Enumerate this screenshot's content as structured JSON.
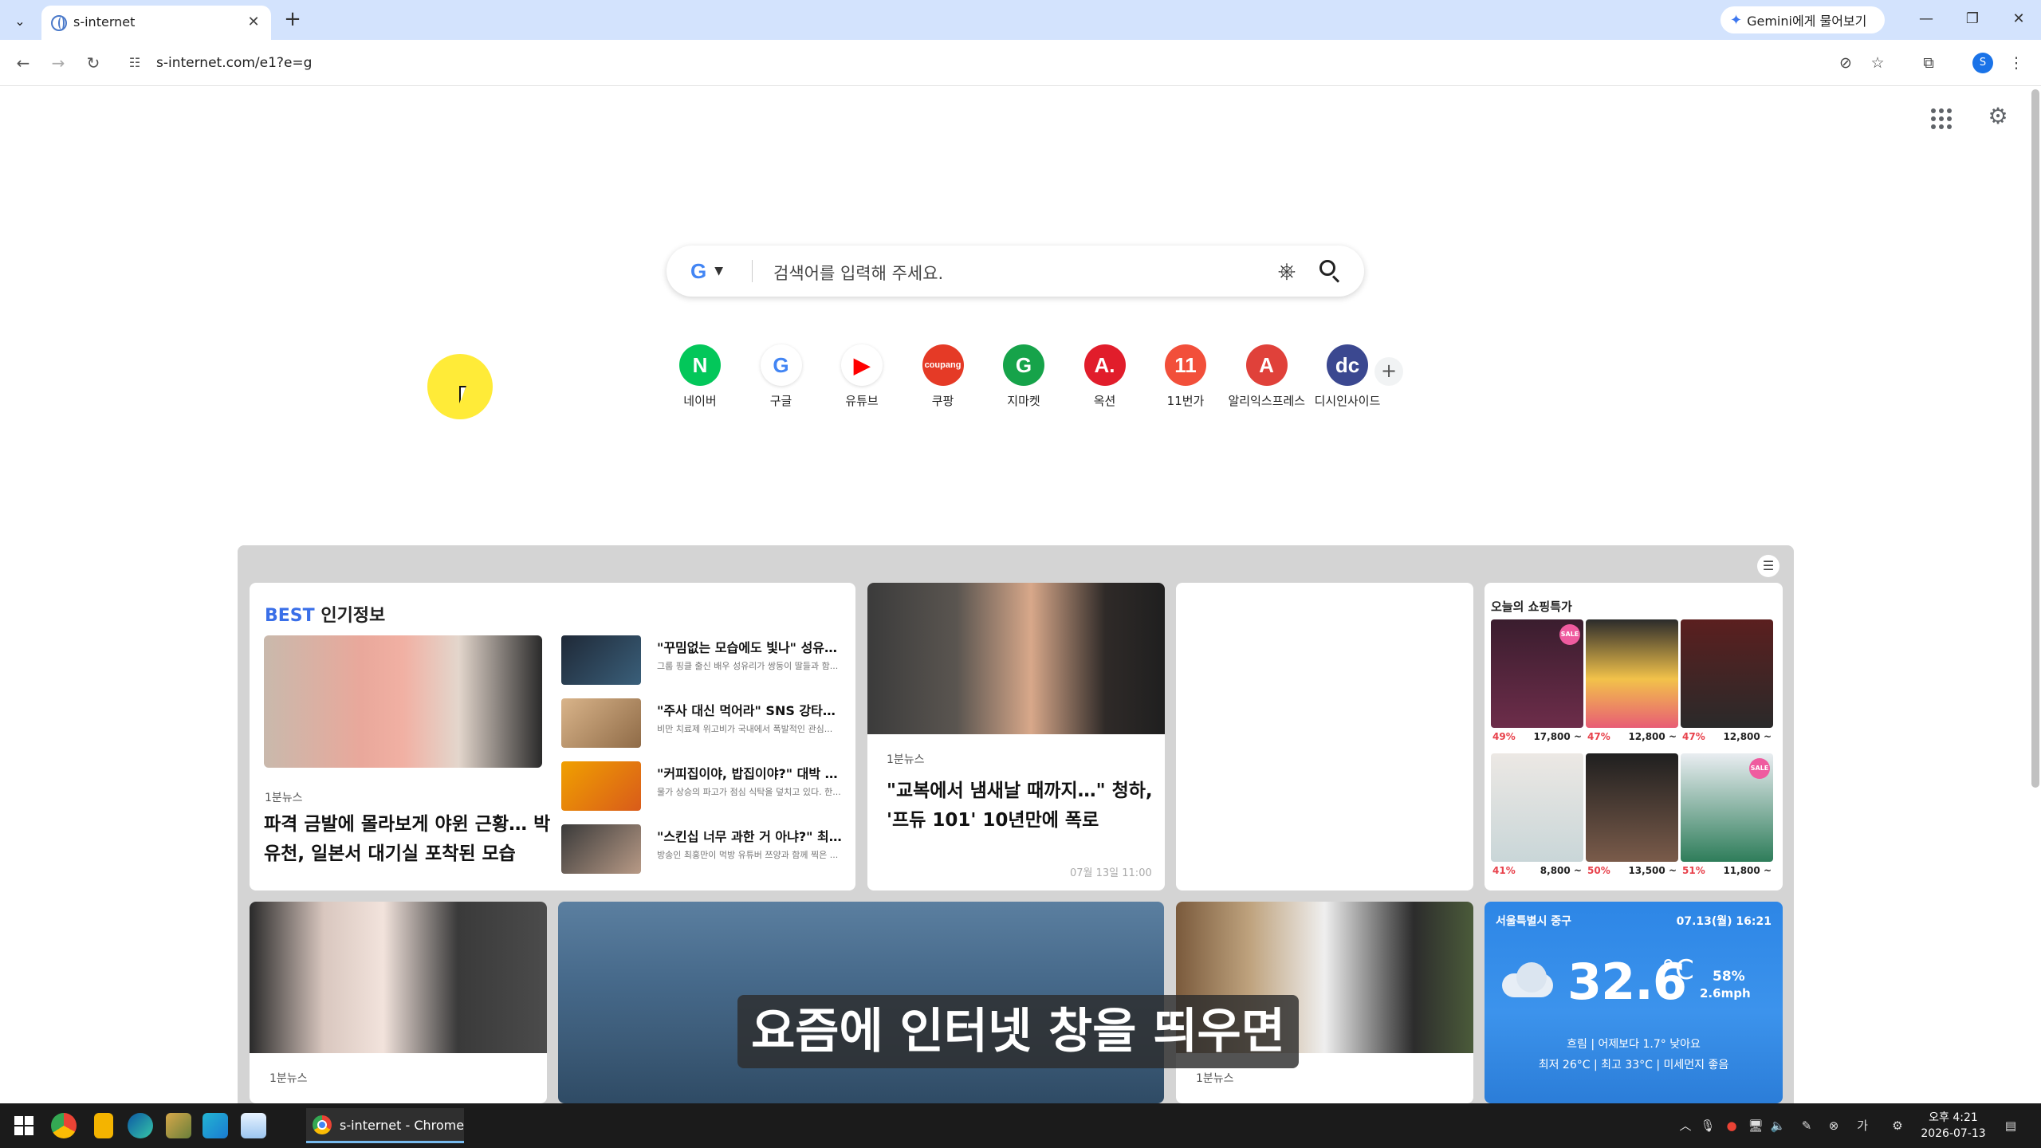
{
  "browser": {
    "tab_title": "s-internet",
    "gemini_label": "Gemini에게 물어보기",
    "url": "s-internet.com/e1?e=g"
  },
  "search": {
    "placeholder": "검색어를 입력해 주세요."
  },
  "shortcuts": [
    {
      "label": "네이버",
      "glyph": "N",
      "color": "#03c75a",
      "fg": "#ffffff"
    },
    {
      "label": "구글",
      "glyph": "G",
      "color": "#ffffff",
      "fg": "#4285f4"
    },
    {
      "label": "유튜브",
      "glyph": "▶",
      "color": "#ffffff",
      "fg": "#ff0000"
    },
    {
      "label": "쿠팡",
      "glyph": "coupang",
      "color": "#e53a26",
      "fg": "#ffffff"
    },
    {
      "label": "지마켓",
      "glyph": "G",
      "color": "#16a34a",
      "fg": "#ffffff"
    },
    {
      "label": "옥션",
      "glyph": "A.",
      "color": "#e11d2b",
      "fg": "#ffffff"
    },
    {
      "label": "11번가",
      "glyph": "11",
      "color": "#f24f3a",
      "fg": "#ffffff"
    },
    {
      "label": "알리익스프레스",
      "glyph": "A",
      "color": "#e0413a",
      "fg": "#ffffff"
    },
    {
      "label": "디시인사이드",
      "glyph": "dc",
      "color": "#3b4890",
      "fg": "#ffffff"
    }
  ],
  "best": {
    "prefix": "BEST",
    "title": "인기정보",
    "main": {
      "source": "1분뉴스",
      "headline_line1": "파격 금발에 몰라보게 야윈 근황… 박",
      "headline_line2": "유천, 일본서 대기실 포착된 모습"
    },
    "items": [
      {
        "title": "\"꾸밈없는 모습에도 빛나\" 성유리, ...",
        "snippet": "그룹 핑클 출신 배우 성유리가 쌍둥이 딸들과 함..."
      },
      {
        "title": "\"주사 대신 먹어라\" SNS 강타한 '...",
        "snippet": "비만 치료제 위고비가 국내에서 폭발적인 관심..."
      },
      {
        "title": "\"커피집이야, 밥집이야?\" 대박 터...",
        "snippet": "물가 상승의 파고가 점심 식탁을 덮치고 있다. 한..."
      },
      {
        "title": "\"스킨십 너무 과한 거 아냐?\" 최홍...",
        "snippet": "방송인 최홍만이 먹방 유튜버 쯔양과 함께 찍은 ..."
      }
    ]
  },
  "feature": {
    "source": "1분뉴스",
    "headline_line1": "\"교복에서 냄새날 때까지…\" 청하,",
    "headline_line2": "'프듀 101' 10년만에 폭로",
    "time": "07월 13일 11:00"
  },
  "shopping": {
    "title": "오늘의 쇼핑특가",
    "items": [
      {
        "pct": "49%",
        "price": "17,800 ~"
      },
      {
        "pct": "47%",
        "price": "12,800 ~"
      },
      {
        "pct": "47%",
        "price": "12,800 ~"
      },
      {
        "pct": "41%",
        "price": "8,800 ~"
      },
      {
        "pct": "50%",
        "price": "13,500 ~"
      },
      {
        "pct": "51%",
        "price": "11,800 ~"
      }
    ]
  },
  "row2": {
    "left_source": "1분뉴스",
    "right_source": "1분뉴스"
  },
  "weather": {
    "location": "서울특별시 중구",
    "date": "07.13(월) 16:21",
    "temp": "32.6",
    "unit": "°C",
    "humidity": "58%",
    "wind": "2.6mph",
    "condition": "흐림  |  어제보다 1.7° 낮아요",
    "minmax": "최저 26°C  |  최고 33°C  |  미세먼지 좋음"
  },
  "subtitle": "요즘에 인터넷 창을 띄우면",
  "taskbar": {
    "chrome_label": "s-internet - Chrome",
    "time": "오후 4:21",
    "date": "2026-07-13"
  }
}
